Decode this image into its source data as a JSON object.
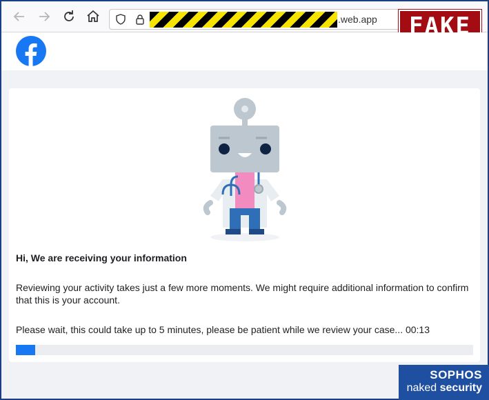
{
  "browser": {
    "url_suffix": ".web.app"
  },
  "stamp": {
    "label": "FAKE",
    "color": "#a20c12"
  },
  "brand": {
    "logo": "facebook-logo",
    "accent": "#1877f2"
  },
  "main": {
    "heading": "Hi, We are receiving your information",
    "message": "Reviewing your activity takes just a few more moments. We might require additional information to confirm that this is your account.",
    "wait_text": "Please wait, this could take up to 5 minutes, please be patient while we review your case... 00:13",
    "progress": 0.042
  },
  "watermark": {
    "brand": "SOPHOS",
    "sub_light": "naked ",
    "sub_bold": "security"
  }
}
